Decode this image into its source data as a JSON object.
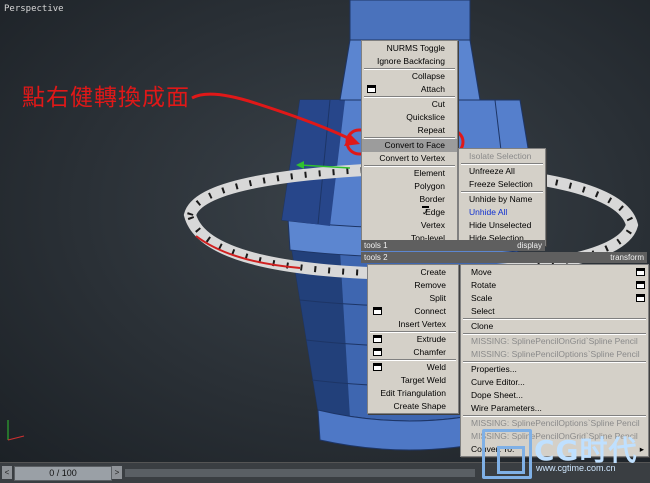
{
  "viewport": {
    "label": "Perspective"
  },
  "annotation": {
    "text": "點右健轉換成面"
  },
  "quad_menu": {
    "left_top_items": [
      {
        "label": "NURMS Toggle",
        "box": false,
        "state": "normal"
      },
      {
        "label": "Ignore Backfacing",
        "box": false,
        "state": "normal"
      },
      {
        "sep": true
      },
      {
        "label": "Collapse",
        "box": false,
        "state": "normal"
      },
      {
        "label": "Attach",
        "box": true,
        "state": "normal"
      },
      {
        "sep": true
      },
      {
        "label": "Cut",
        "box": false,
        "state": "normal"
      },
      {
        "label": "Quickslice",
        "box": false,
        "state": "normal"
      },
      {
        "label": "Repeat",
        "box": false,
        "state": "normal"
      },
      {
        "sep": true
      },
      {
        "label": "Convert to Face",
        "box": false,
        "state": "highlight"
      },
      {
        "label": "Convert to Vertex",
        "box": false,
        "state": "normal"
      },
      {
        "sep": true
      },
      {
        "label": "Element",
        "box": false,
        "state": "normal"
      },
      {
        "label": "Polygon",
        "box": false,
        "state": "normal"
      },
      {
        "label": "Border",
        "box": false,
        "state": "normal"
      },
      {
        "label": "Edge",
        "box": false,
        "state": "checked"
      },
      {
        "label": "Vertex",
        "box": false,
        "state": "normal"
      },
      {
        "label": "Top-level",
        "box": false,
        "state": "normal"
      }
    ],
    "right_top_items": [
      {
        "label": "Isolate Selection",
        "state": "disabled"
      },
      {
        "sep": true
      },
      {
        "label": "Unfreeze All",
        "state": "normal"
      },
      {
        "label": "Freeze Selection",
        "state": "normal"
      },
      {
        "sep": true
      },
      {
        "label": "Unhide by Name",
        "state": "normal"
      },
      {
        "label": "Unhide All",
        "state": "blue"
      },
      {
        "label": "Hide Unselected",
        "state": "normal"
      },
      {
        "label": "Hide Selection",
        "state": "normal"
      }
    ],
    "headers": {
      "tools1": "tools 1",
      "display": "display",
      "tools2": "tools 2",
      "transform": "transform"
    },
    "left_bottom_items": [
      {
        "label": "Create",
        "box": false
      },
      {
        "label": "Remove",
        "box": false
      },
      {
        "label": "Split",
        "box": false
      },
      {
        "label": "Connect",
        "box": true
      },
      {
        "label": "Insert Vertex",
        "box": false
      },
      {
        "sep": true
      },
      {
        "label": "Extrude",
        "box": true
      },
      {
        "label": "Chamfer",
        "box": true
      },
      {
        "sep": true
      },
      {
        "label": "Weld",
        "box": true
      },
      {
        "label": "Target Weld",
        "box": false
      },
      {
        "label": "Edit Triangulation",
        "box": false
      },
      {
        "label": "Create Shape",
        "box": false
      }
    ],
    "right_bottom_items": [
      {
        "label": "Move",
        "box": true,
        "state": "normal"
      },
      {
        "label": "Rotate",
        "box": true,
        "state": "normal"
      },
      {
        "label": "Scale",
        "box": true,
        "state": "normal"
      },
      {
        "label": "Select",
        "box": false,
        "state": "normal"
      },
      {
        "sep": true
      },
      {
        "label": "Clone",
        "box": false,
        "state": "normal"
      },
      {
        "sep": true
      },
      {
        "label": "MISSING: SplinePencilOnGrid`Spline Pencil",
        "box": false,
        "state": "disabled"
      },
      {
        "label": "MISSING: SplinePencilOptions`Spline Pencil",
        "box": false,
        "state": "disabled"
      },
      {
        "sep": true
      },
      {
        "label": "Properties...",
        "box": false,
        "state": "normal"
      },
      {
        "label": "Curve Editor...",
        "box": false,
        "state": "normal"
      },
      {
        "label": "Dope Sheet...",
        "box": false,
        "state": "normal"
      },
      {
        "label": "Wire Parameters...",
        "box": false,
        "state": "normal"
      },
      {
        "sep": true
      },
      {
        "label": "MISSING: SplinePencilOptions`Spline Pencil",
        "box": false,
        "state": "disabled"
      },
      {
        "label": "MISSING: SplinePencilOnGrid`Spline Pencil",
        "box": false,
        "state": "disabled"
      },
      {
        "label": "Convert To:",
        "box": false,
        "state": "submenu"
      }
    ]
  },
  "timeline": {
    "frame_label": "0 / 100",
    "left_arrow": "<",
    "right_arrow": ">"
  },
  "watermark": {
    "brand": "CG时代",
    "url": "www.cgtime.com.cn"
  },
  "colors": {
    "mesh": "#4e78c6",
    "mesh_dark": "#2a4a8e",
    "menu_bg": "#d4d0c8",
    "annotation": "#e01818"
  }
}
